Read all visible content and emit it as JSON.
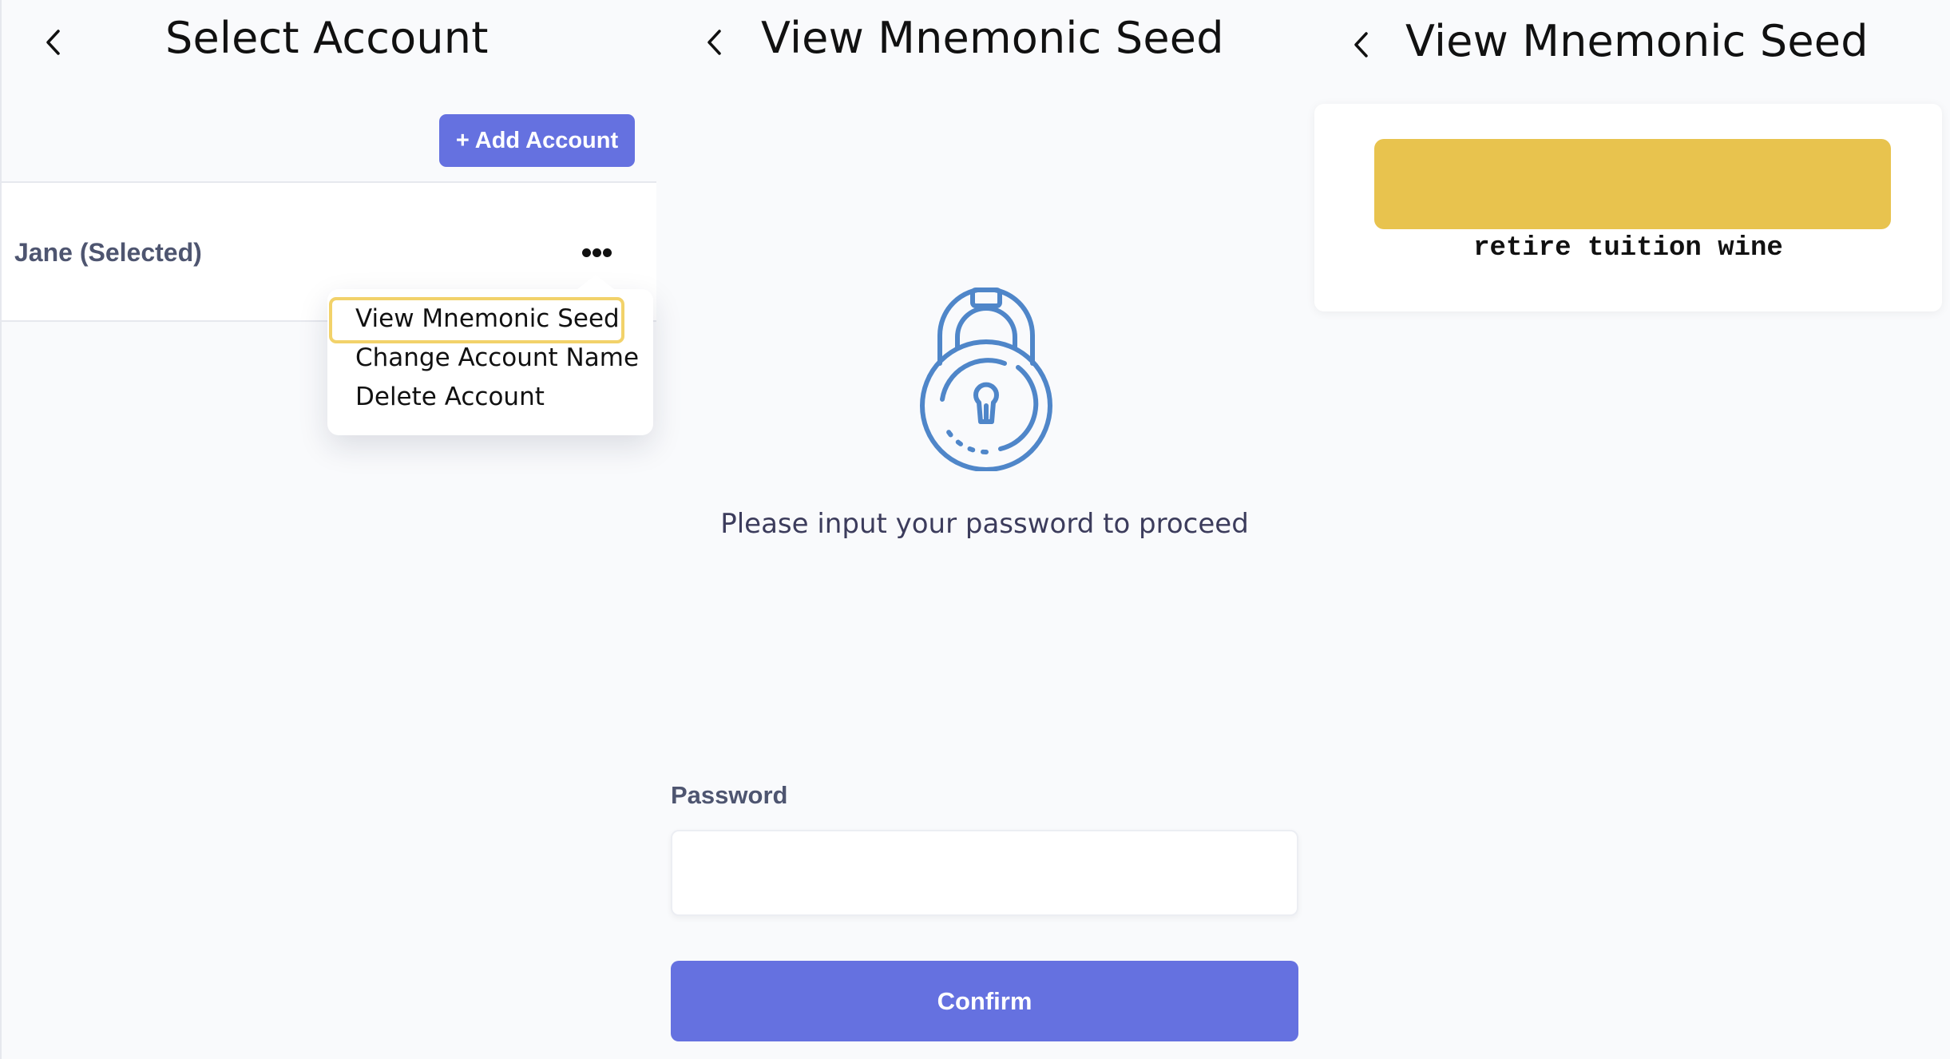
{
  "screens": [
    {
      "title": "Select Account",
      "add_account_label": "+ Add Account",
      "account_name": "Jane (Selected)",
      "menu_items": [
        "View Mnemonic Seed",
        "Change Account Name",
        "Delete Account"
      ],
      "highlighted_menu_item": "View Mnemonic Seed"
    },
    {
      "title": "View Mnemonic Seed",
      "prompt": "Please input your password to proceed",
      "password_label": "Password",
      "password_value": "",
      "confirm_label": "Confirm"
    },
    {
      "title": "View Mnemonic Seed",
      "seed_text": "retire tuition wine"
    }
  ],
  "colors": {
    "accent": "#6571e0",
    "highlight": "#f2d26a",
    "seed_mask": "#e8c34e",
    "lock_icon": "#4f86c9",
    "background": "#f9fafc"
  },
  "icons": {
    "back": "chevron-left-icon",
    "more": "more-horizontal-icon",
    "lock": "padlock-icon"
  }
}
